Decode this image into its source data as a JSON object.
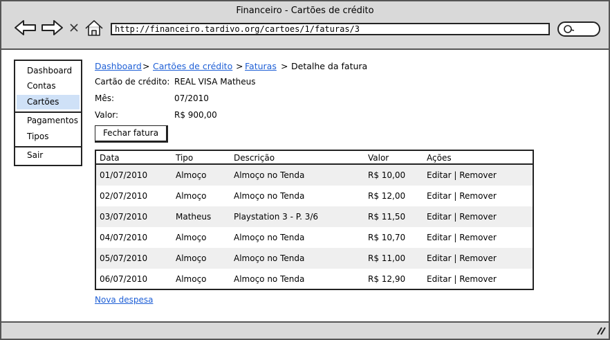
{
  "window": {
    "title": "Financeiro - Cartões de crédito"
  },
  "browser": {
    "url": "http://financeiro.tardivo.org/cartoes/1/faturas/3",
    "icons": [
      "back-arrow-icon",
      "forward-arrow-icon",
      "close-icon",
      "home-icon",
      "search-icon",
      "resize-grip-icon"
    ]
  },
  "sidebar": {
    "items": [
      {
        "label": "Dashboard"
      },
      {
        "label": "Contas"
      },
      {
        "label": "Cartões",
        "active": true
      },
      {
        "label": "Pagamentos"
      },
      {
        "label": "Tipos"
      },
      {
        "label": "Sair"
      }
    ],
    "active_color": "#cfe1f7"
  },
  "breadcrumb": {
    "items": [
      "Dashboard",
      "Cartões de crédito",
      "Faturas",
      "Detalhe da fatura"
    ],
    "separator": ">"
  },
  "details": {
    "card_label": "Cartão de crédito:",
    "card_value": "REAL VISA Matheus",
    "month_label": "Mês:",
    "month_value": "07/2010",
    "value_label": "Valor:",
    "value_value": "R$ 900,00"
  },
  "actions": {
    "close_invoice": "Fechar fatura",
    "new_expense": "Nova despesa"
  },
  "table": {
    "headers": [
      "Data",
      "Tipo",
      "Descrição",
      "Valor",
      "Ações"
    ],
    "rows": [
      [
        "01/07/2010",
        "Almoço",
        "Almoço no Tenda",
        "R$ 10,00",
        "Editar | Remover"
      ],
      [
        "02/07/2010",
        "Almoço",
        "Almoço no Tenda",
        "R$ 12,00",
        "Editar | Remover"
      ],
      [
        "03/07/2010",
        "Matheus",
        "Playstation 3 - P. 3/6",
        "R$ 11,50",
        "Editar | Remover"
      ],
      [
        "04/07/2010",
        "Almoço",
        "Almoço no Tenda",
        "R$ 10,70",
        "Editar | Remover"
      ],
      [
        "05/07/2010",
        "Almoço",
        "Almoço no Tenda",
        "R$ 11,00",
        "Editar | Remover"
      ],
      [
        "06/07/2010",
        "Almoço",
        "Almoço no Tenda",
        "R$ 12,90",
        "Editar | Remover"
      ]
    ]
  },
  "colors": {
    "link": "#1e5fd6",
    "chrome": "#d9d9d9",
    "row_alt": "#efefef"
  }
}
